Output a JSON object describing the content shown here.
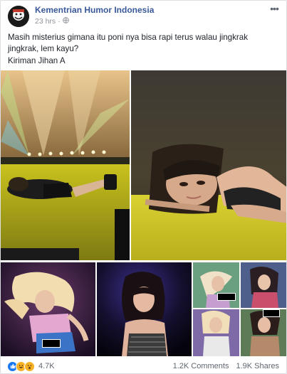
{
  "post": {
    "page_name": "Kementrian Humor Indonesia",
    "time": "23 hrs",
    "separator": "·",
    "text": "Masih misterius gimana itu poni nya bisa rapi terus walau jingkrak jingkrak, lem kayu?",
    "credit": "Kiriman Jihan A"
  },
  "footer": {
    "reaction_count": "4.7K",
    "comments": "1.2K Comments",
    "shares": "1.9K Shares"
  },
  "icons": {
    "privacy": "globe-icon",
    "more": "more-options-icon",
    "reactions": [
      "like-icon",
      "haha-icon",
      "wow-icon"
    ]
  },
  "colors": {
    "link": "#385898",
    "meta": "#90949c",
    "like": "#1877f2",
    "emoji": "#f7b125"
  }
}
